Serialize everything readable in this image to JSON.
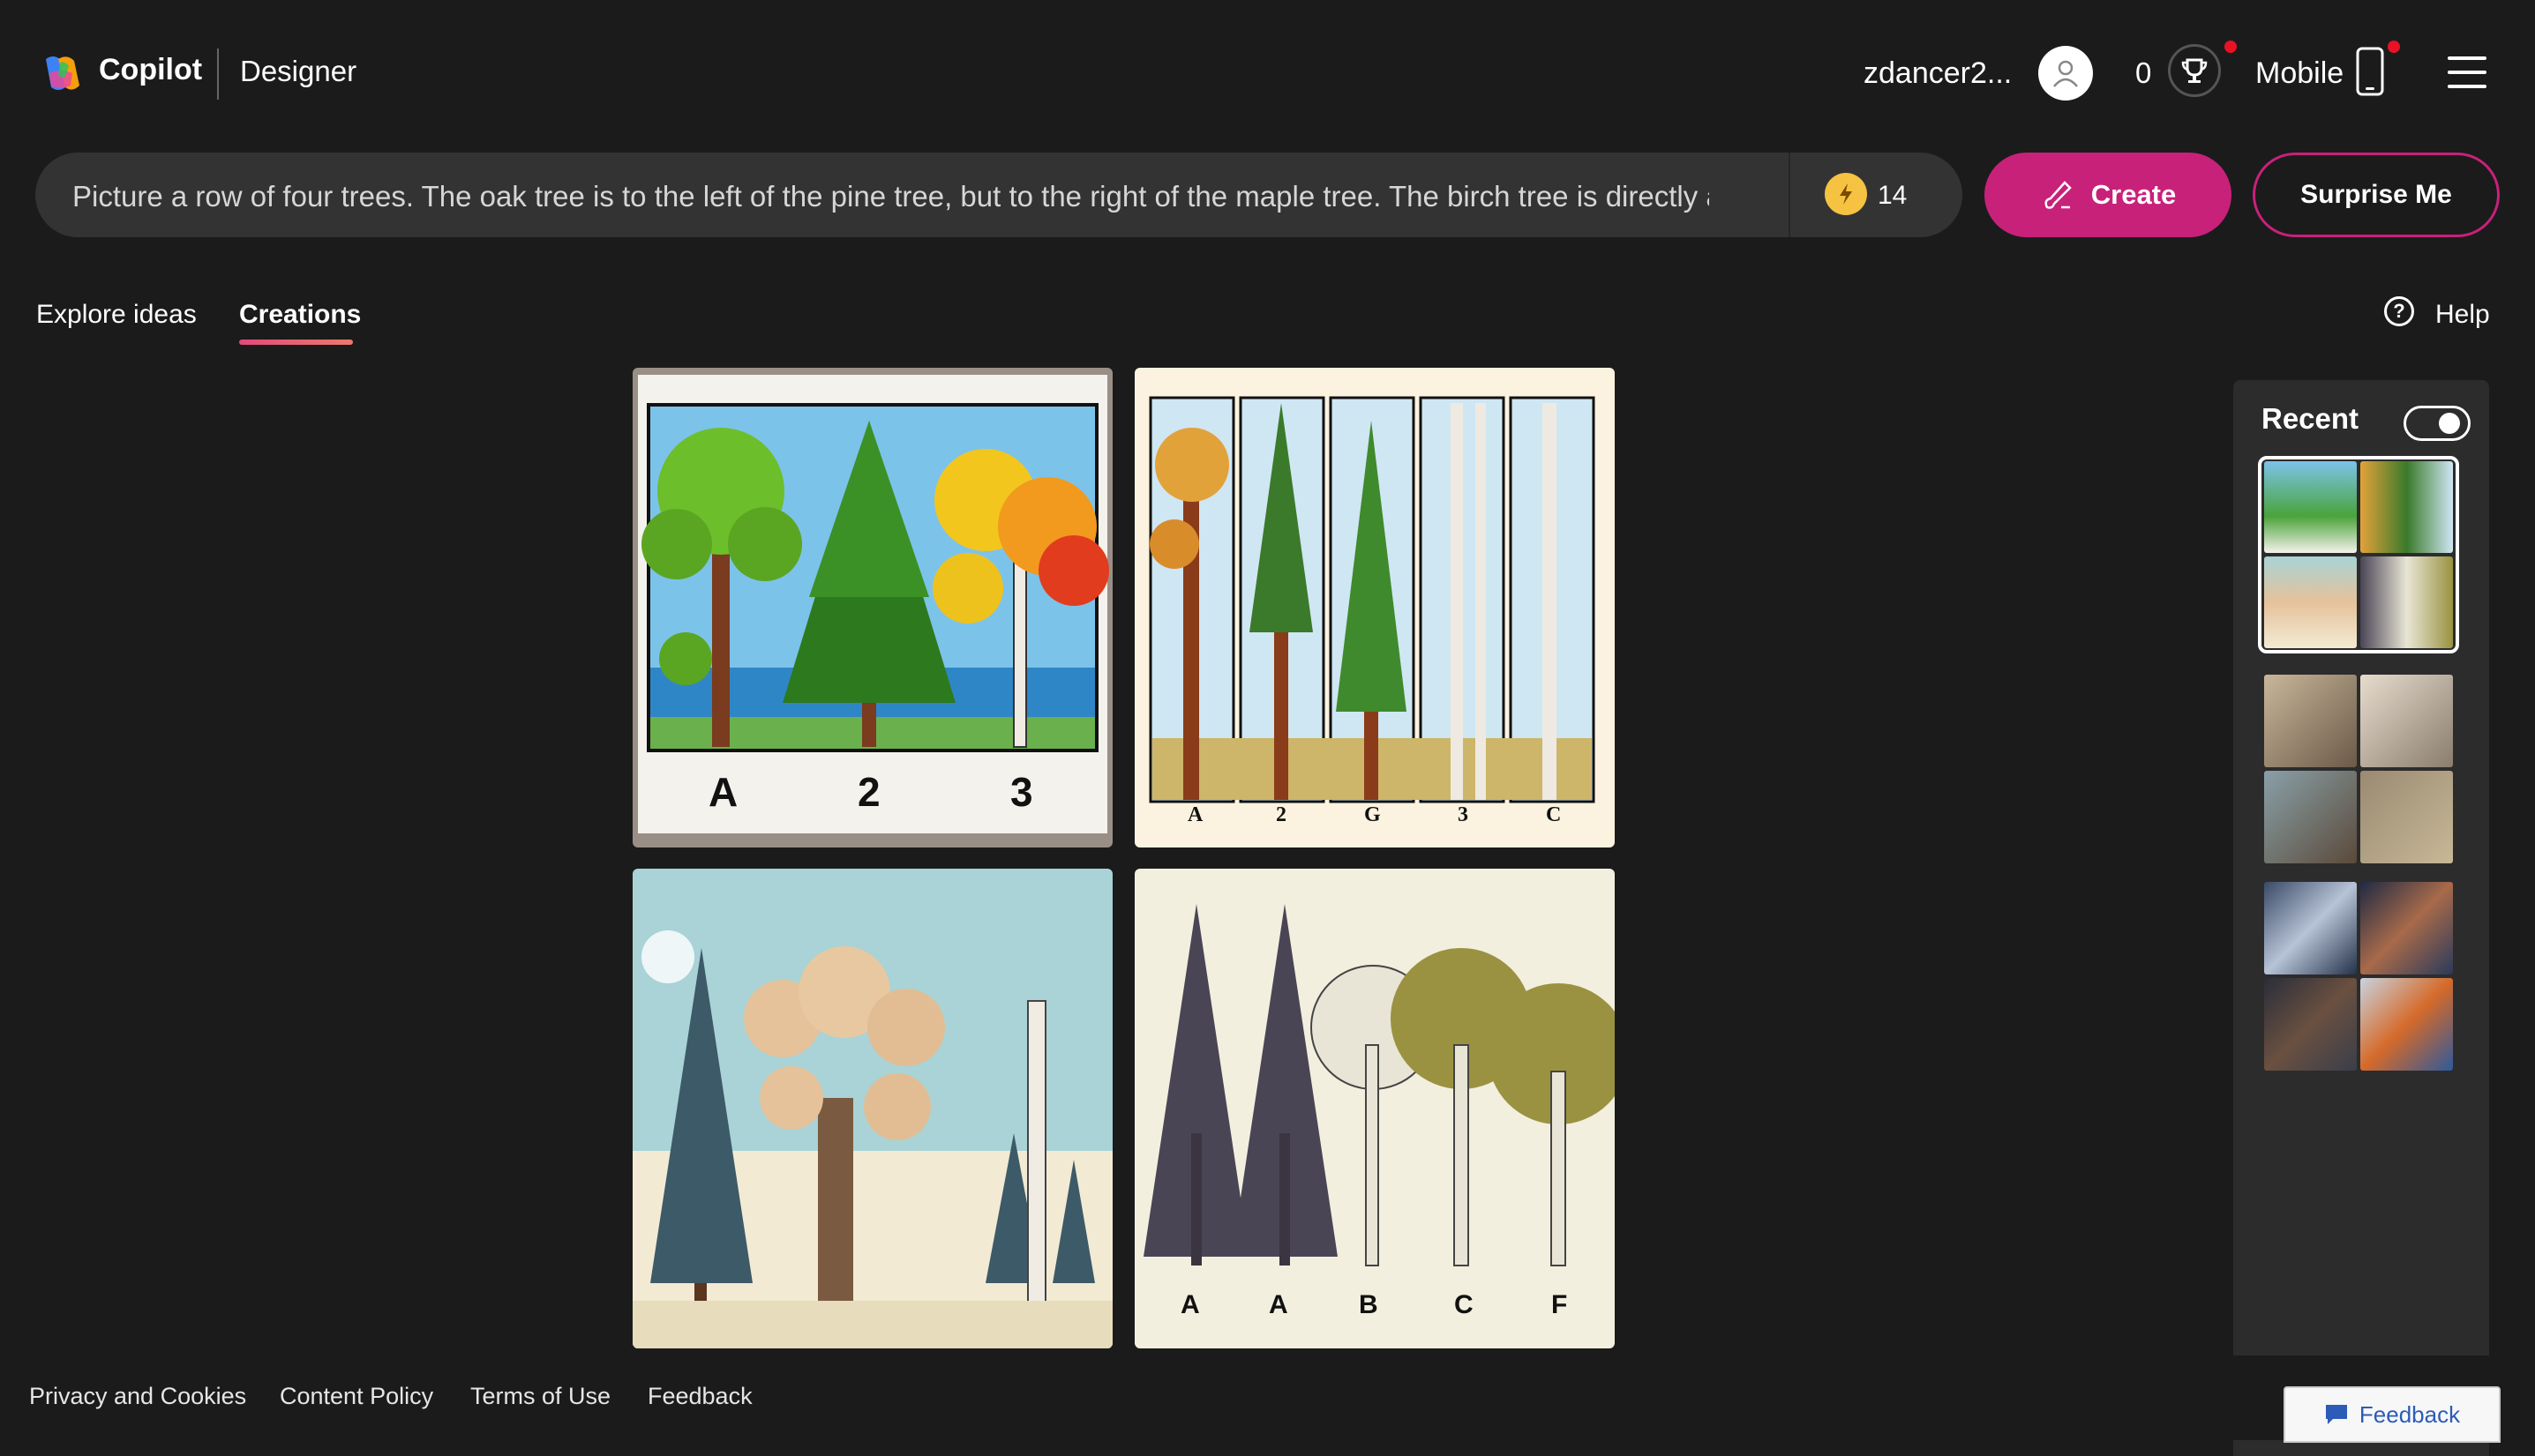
{
  "header": {
    "brand": "Copilot",
    "product": "Designer",
    "username": "zdancer2...",
    "points": "0",
    "mobile_label": "Mobile"
  },
  "prompt": {
    "text": "Picture a row of four trees. The oak tree is to the left of the pine tree, but to the right of the maple tree. The birch tree is directly a",
    "boosts": "14",
    "create_label": "Create",
    "surprise_label": "Surprise Me"
  },
  "tabs": {
    "explore": "Explore ideas",
    "creations": "Creations",
    "help": "Help"
  },
  "images": {
    "img1_labels": [
      "A",
      "2",
      "3"
    ],
    "img2_labels": [
      "A",
      "2",
      "G",
      "3",
      "C"
    ],
    "img4_labels": [
      "A",
      "A",
      "B",
      "C",
      "F"
    ]
  },
  "sidebar": {
    "title": "Recent"
  },
  "footer": {
    "privacy": "Privacy and Cookies",
    "content_policy": "Content Policy",
    "terms": "Terms of Use",
    "feedback": "Feedback",
    "feedback_button": "Feedback"
  },
  "colors": {
    "accent": "#c8217a",
    "background": "#1b1b1b"
  }
}
